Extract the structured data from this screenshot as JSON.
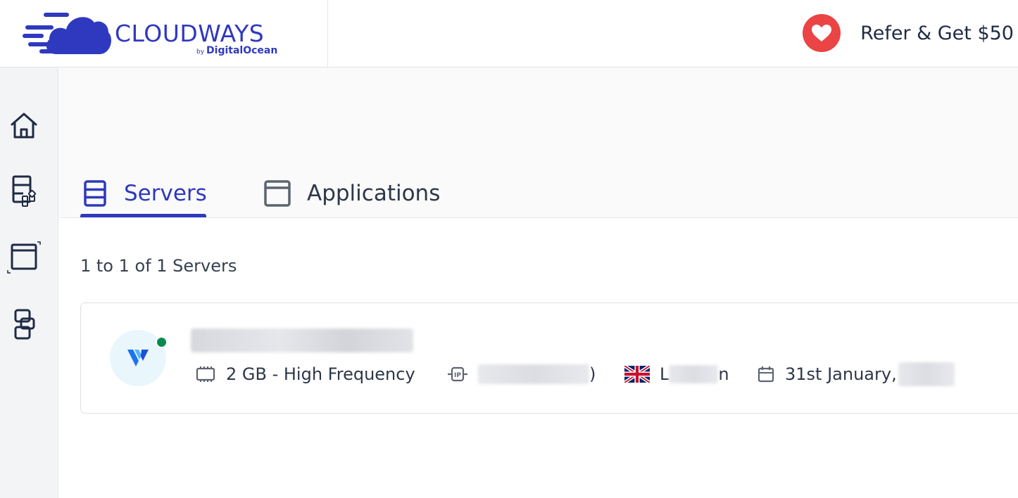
{
  "brand": {
    "name": "CLOUDWAYS",
    "sub_prefix": "by",
    "sub_name": "DigitalOcean",
    "color": "#2f39bf"
  },
  "header": {
    "refer_label": "Refer & Get $50",
    "refer_icon": "heart-icon",
    "refer_color": "#ea4444"
  },
  "sidebar": {
    "items": [
      {
        "name": "home",
        "icon": "home-icon"
      },
      {
        "name": "servers",
        "icon": "server-apps-icon"
      },
      {
        "name": "applications",
        "icon": "app-window-icon"
      },
      {
        "name": "projects",
        "icon": "projects-icon"
      }
    ]
  },
  "tabs": {
    "servers_label": "Servers",
    "applications_label": "Applications",
    "active": "Servers"
  },
  "listing": {
    "count_text": "1 to 1 of 1 Servers"
  },
  "server": {
    "provider_icon": "vultr-logo-icon",
    "status": "running",
    "status_color": "#0b8a4e",
    "size": "2 GB - High Frequency",
    "ip_tail": ")",
    "location_first": "L",
    "location_last": "n",
    "location_flag": "uk-flag-icon",
    "date_visible": "31st January,"
  }
}
